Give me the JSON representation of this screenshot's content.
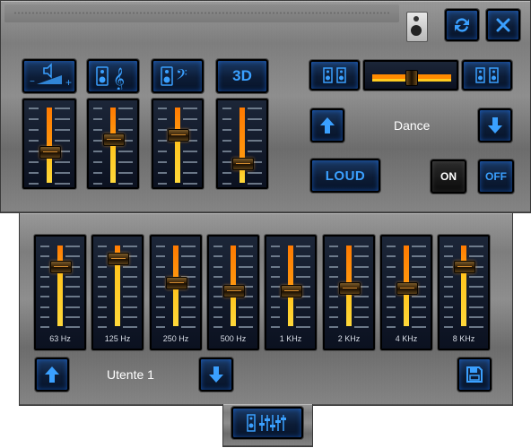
{
  "preset": {
    "name": "Dance"
  },
  "user_preset": {
    "name": "Utente 1"
  },
  "buttons": {
    "loud": "LOUD",
    "on": "ON",
    "off": "OFF",
    "three_d": "3D"
  },
  "top_sliders": [
    {
      "id": "volume",
      "icon": "volume-icon",
      "level": 0.42
    },
    {
      "id": "treble",
      "icon": "treble-clef-icon",
      "level": 0.58
    },
    {
      "id": "bass",
      "icon": "bass-clef-icon",
      "level": 0.64
    },
    {
      "id": "3d",
      "icon": "3d-label",
      "level": 0.26
    }
  ],
  "balance": {
    "level": 0.5
  },
  "eq_bands": [
    {
      "label": "63 Hz",
      "level": 0.74
    },
    {
      "label": "125 Hz",
      "level": 0.84
    },
    {
      "label": "250 Hz",
      "level": 0.54
    },
    {
      "label": "500 Hz",
      "level": 0.44
    },
    {
      "label": "1 KHz",
      "level": 0.44
    },
    {
      "label": "2 KHz",
      "level": 0.48
    },
    {
      "label": "4 KHz",
      "level": 0.48
    },
    {
      "label": "8 KHz",
      "level": 0.74
    }
  ],
  "colors": {
    "accent_blue": "#3aa0ff",
    "slider_orange": "#ff8a00",
    "slider_yellow": "#ffcc20"
  }
}
